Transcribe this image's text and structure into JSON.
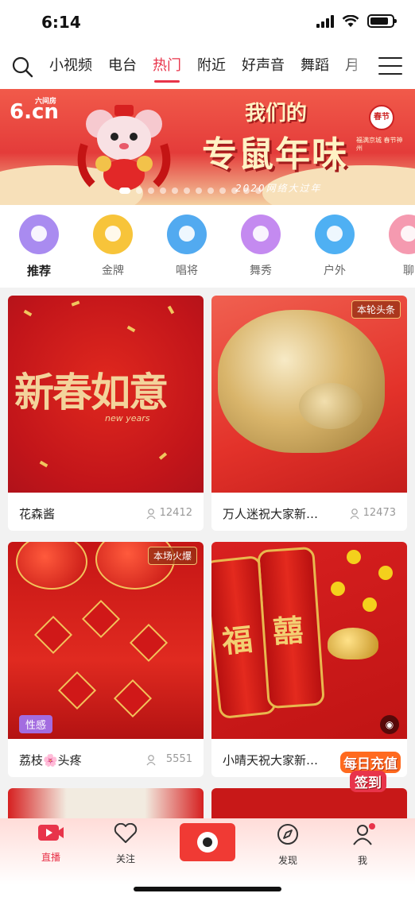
{
  "status_bar": {
    "time": "6:14"
  },
  "top_nav": {
    "tabs": [
      {
        "label": "小视频",
        "active": false
      },
      {
        "label": "电台",
        "active": false
      },
      {
        "label": "热门",
        "active": true
      },
      {
        "label": "附近",
        "active": false
      },
      {
        "label": "好声音",
        "active": false
      },
      {
        "label": "舞蹈",
        "active": false
      },
      {
        "label": "月",
        "active": false
      }
    ]
  },
  "banner": {
    "logo": "6.cn",
    "logo_small": "六间房",
    "line1": "我们的",
    "line2": "专鼠年味",
    "line3": "2020网络大过年",
    "seal": "春节",
    "seal_text": "福满京城 春节神州"
  },
  "categories": [
    {
      "label": "推荐",
      "color": "#a98bf0",
      "active": true
    },
    {
      "label": "金牌",
      "color": "#f7c43a",
      "active": false
    },
    {
      "label": "唱将",
      "color": "#52aaf0",
      "active": false
    },
    {
      "label": "舞秀",
      "color": "#c48af0",
      "active": false
    },
    {
      "label": "户外",
      "color": "#4fb0f3",
      "active": false
    },
    {
      "label": "聊",
      "color": "#f59ab0",
      "active": false
    }
  ],
  "feed": {
    "cards": [
      {
        "name": "花森酱",
        "count": "12412",
        "badge": "",
        "tag": "",
        "image_text": "新春如意",
        "image_sub": "new years"
      },
      {
        "name": "万人迷祝大家新…",
        "count": "12473",
        "badge": "本轮头条",
        "tag": ""
      },
      {
        "name": "荔枝🌸头疼",
        "count": "5551",
        "badge": "本场火爆",
        "tag": "性感"
      },
      {
        "name": "小晴天祝大家新…",
        "count": "",
        "badge": "",
        "tag": ""
      }
    ],
    "cracker_chars": [
      "福",
      "囍"
    ]
  },
  "checkin": {
    "line1": "每日充值",
    "line2": "签到"
  },
  "tabbar": {
    "items": [
      {
        "label": "直播",
        "active": true
      },
      {
        "label": "关注",
        "active": false
      },
      {
        "label": "发现",
        "active": false
      },
      {
        "label": "我",
        "active": false
      }
    ]
  },
  "colors": {
    "accent": "#e8344a",
    "feed_bg": "#f2f2f2"
  }
}
